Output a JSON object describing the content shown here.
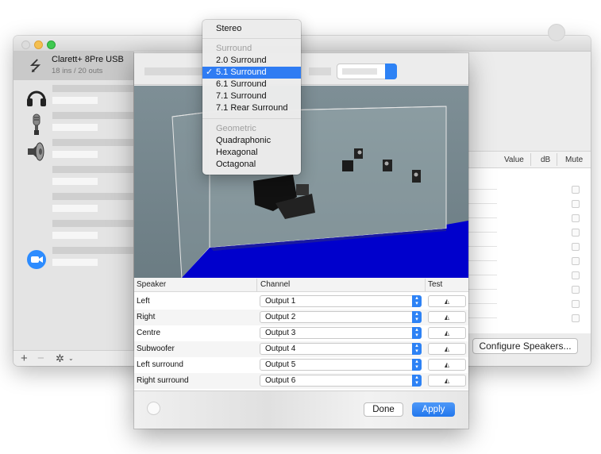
{
  "sidebar": {
    "device": {
      "name": "Clarett+ 8Pre USB",
      "subtitle": "18 ins / 20 outs",
      "icon": "usb-icon"
    },
    "rows": [
      {
        "icon": "headphones-icon"
      },
      {
        "icon": "microphone-icon"
      },
      {
        "icon": "speaker-icon"
      },
      {
        "icon": ""
      },
      {
        "icon": ""
      },
      {
        "icon": ""
      },
      {
        "icon": "zoom-video-icon"
      }
    ],
    "footer": {
      "add": "+",
      "remove": "−",
      "gear": "✲",
      "caret": "⌄"
    }
  },
  "io_table": {
    "headers": {
      "value": "Value",
      "db": "dB",
      "mute": "Mute"
    }
  },
  "configure_button": "Configure Speakers...",
  "speaker_table": {
    "headers": {
      "speaker": "Speaker",
      "channel": "Channel",
      "test": "Test"
    },
    "rows": [
      {
        "speaker": "Left",
        "channel": "Output 1"
      },
      {
        "speaker": "Right",
        "channel": "Output 2"
      },
      {
        "speaker": "Centre",
        "channel": "Output 3"
      },
      {
        "speaker": "Subwoofer",
        "channel": "Output 4"
      },
      {
        "speaker": "Left surround",
        "channel": "Output 5"
      },
      {
        "speaker": "Right surround",
        "channel": "Output 6"
      }
    ]
  },
  "buttons": {
    "done": "Done",
    "apply": "Apply"
  },
  "menu": {
    "stereo": "Stereo",
    "surround_header": "Surround",
    "surround": [
      "2.0 Surround",
      "5.1 Surround",
      "6.1 Surround",
      "7.1 Surround",
      "7.1 Rear Surround"
    ],
    "selected": "5.1 Surround",
    "geometric_header": "Geometric",
    "geometric": [
      "Quadraphonic",
      "Hexagonal",
      "Octagonal"
    ]
  },
  "colors": {
    "accent": "#2f7cf3",
    "floor": "#0000c8",
    "scene_bg": "#73848b"
  }
}
